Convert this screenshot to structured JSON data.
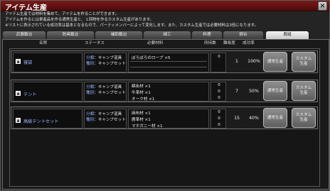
{
  "window": {
    "title": "アイテム生産",
    "close": "×"
  },
  "description": [
    "アイテム生産では材料を集めて、アイテムを作ることができます。",
    "アイテムを作るには単産品を作る通常生産と、１回物を作るカスタム生産があります。",
    "※リストに表示されている成功率は基本となるもので、パーティメンバーによって変化します。また、カスタム生産では必要材料は3倍になります。"
  ],
  "tabs": [
    {
      "label": "武器鍛冶",
      "active": false
    },
    {
      "label": "防具鍛冶",
      "active": false
    },
    {
      "label": "補助鍛冶",
      "active": false
    },
    {
      "label": "細工",
      "active": false
    },
    {
      "label": "料理",
      "active": false
    },
    {
      "label": "調合",
      "active": false
    },
    {
      "label": "裁縫",
      "active": true
    }
  ],
  "columns": {
    "name": "名称",
    "status": "ステータス",
    "materials": "必要材料",
    "owned": "所持数",
    "difficulty": "難易度",
    "rate": "成功率"
  },
  "status_labels": {
    "category": "分類",
    "type": "種別"
  },
  "items": [
    {
      "toggle": "▲",
      "name": "寝袋",
      "category": "キャンプ道具",
      "type": "キャンプセット",
      "materials": [
        "ぼろぼろのロープ ×5"
      ],
      "owned": [
        "0"
      ],
      "difficulty": "1",
      "rate": "100%",
      "btn_normal": [
        "通常生産"
      ],
      "btn_custom": [
        "カスタム",
        "生産"
      ]
    },
    {
      "toggle": "▲",
      "name": "テント",
      "category": "キャンプ道具",
      "type": "キャンプセット",
      "materials": [
        "綿糸材 ×1",
        "牛革材 ×1",
        "オーク材 ×1"
      ],
      "owned": [
        "0",
        "0",
        "0"
      ],
      "difficulty": "7",
      "rate": "50%",
      "btn_normal": [
        "通常生産"
      ],
      "btn_custom": [
        "カスタム",
        "生産"
      ]
    },
    {
      "toggle": "▲",
      "name": "高級テントセット",
      "category": "キャンプ道具",
      "type": "キャンプセット",
      "materials": [
        "麻布材 ×1",
        "鹿革材 ×1",
        "マホガニー材 ×1"
      ],
      "owned": [
        "0",
        "0",
        "0"
      ],
      "difficulty": "15",
      "rate": "40%",
      "btn_normal": [
        "通常生産"
      ],
      "btn_custom": [
        "カスタム",
        "生産"
      ]
    }
  ]
}
